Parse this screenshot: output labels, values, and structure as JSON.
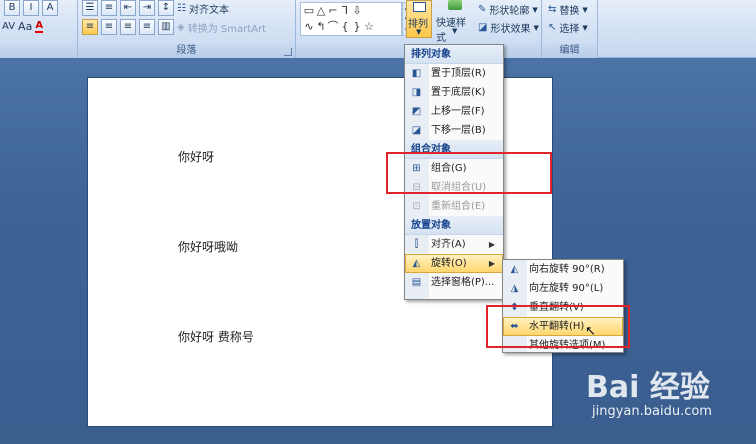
{
  "ribbon": {
    "paragraph_group_label": "段落",
    "align_text_label": "对齐文本",
    "convert_smartart_label": "转换为 SmartArt",
    "arrange_label": "排列",
    "quick_styles_label": "快速样式",
    "shape_outline_label": "形状轮廓",
    "shape_effects_label": "形状效果",
    "replace_label": "替换",
    "select_label": "选择",
    "editing_group_label": "编辑",
    "font_a_label": "A",
    "aa_label": "Aa",
    "av_label": "AV"
  },
  "document": {
    "line1": "你好呀",
    "line2": "你好呀哦呦",
    "line3": "你好呀 费称号"
  },
  "arrange_menu": {
    "header_order": "排列对象",
    "bring_to_front": "置于顶层(R)",
    "send_to_back": "置于底层(K)",
    "bring_forward": "上移一层(F)",
    "send_backward": "下移一层(B)",
    "header_group": "组合对象",
    "group": "组合(G)",
    "ungroup": "取消组合(U)",
    "regroup": "重新组合(E)",
    "header_position": "放置对象",
    "align": "对齐(A)",
    "rotate": "旋转(O)",
    "selection_pane": "选择窗格(P)..."
  },
  "rotate_menu": {
    "rotate_right": "向右旋转 90°(R)",
    "rotate_left": "向左旋转 90°(L)",
    "flip_vertical": "垂直翻转(V)",
    "flip_horizontal": "水平翻转(H)",
    "more_options": "其他旋转选项(M)..."
  },
  "watermark": {
    "brand": "Bai 经验",
    "url": "jingyan.baidu.com"
  },
  "colors": {
    "accent_highlight": "#ffd56b",
    "annotation_red": "#e0242c",
    "workspace_blue": "#3c6296"
  }
}
